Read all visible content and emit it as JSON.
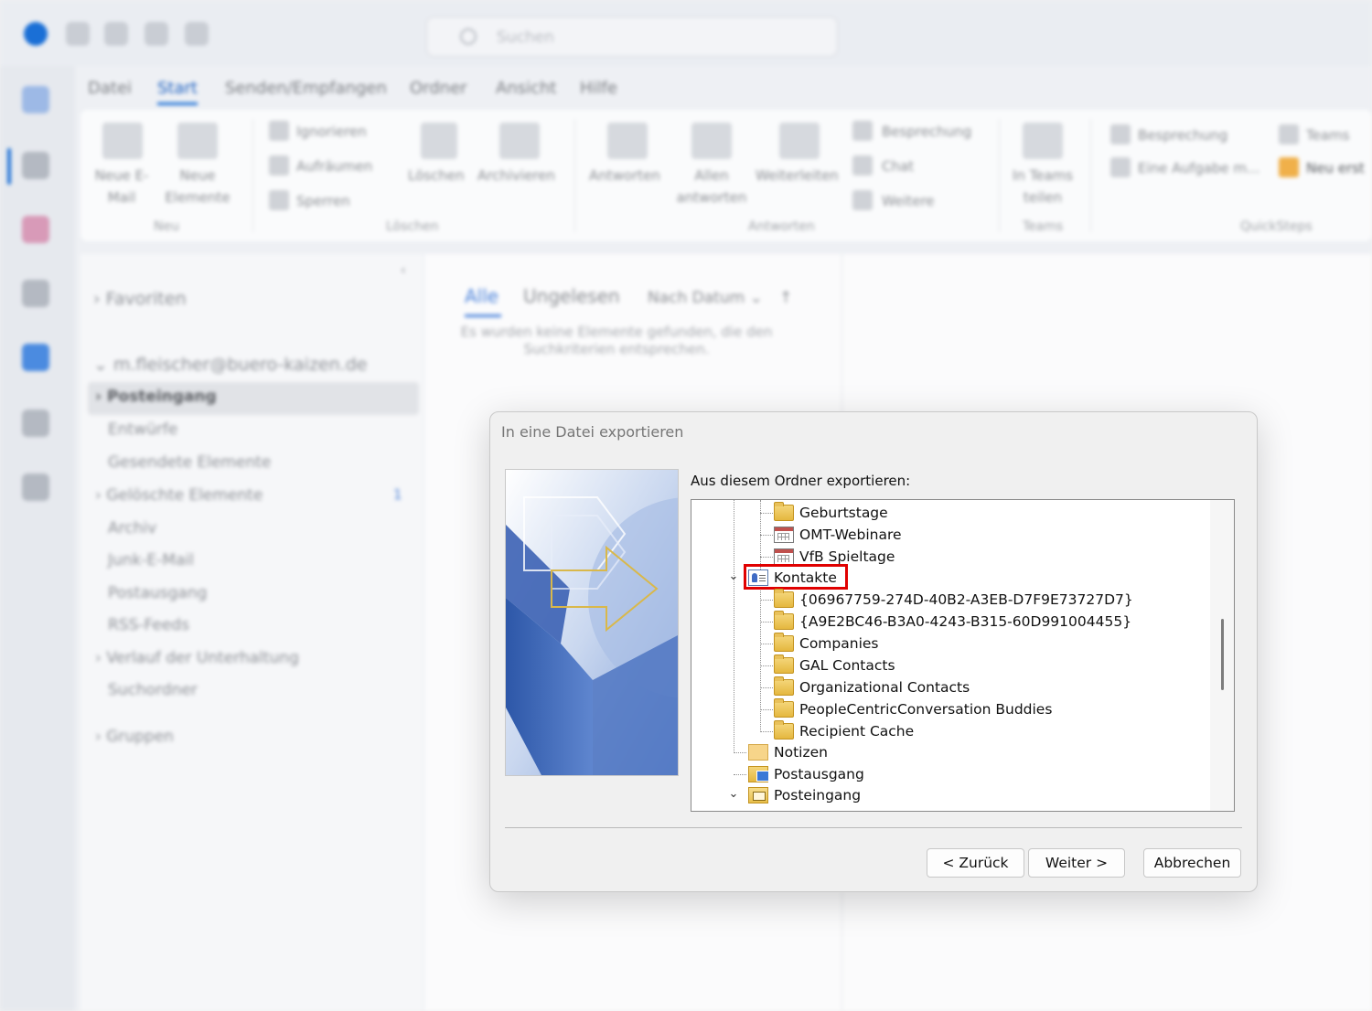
{
  "outlook": {
    "search_placeholder": "Suchen",
    "tabs": [
      "Datei",
      "Start",
      "Senden/Empfangen",
      "Ordner",
      "Ansicht",
      "Hilfe"
    ],
    "ribbon": {
      "new_mail": "Neue E-Mail",
      "new_items": "Neue Elemente",
      "ignore": "Ignorieren",
      "cleanup": "Aufräumen",
      "block": "Sperren",
      "delete": "Löschen",
      "archive": "Archivieren",
      "reply": "Antworten",
      "reply_all": "Allen antworten",
      "forward": "Weiterleiten",
      "meeting": "Besprechung",
      "chat": "Chat",
      "more": "Weitere",
      "teams_share": "In Teams teilen",
      "qs_meeting": "Besprechung",
      "qs_task": "Eine Aufgabe m...",
      "qs_team": "Teams",
      "qs_new": "Neu erst",
      "groups": [
        "Neu",
        "Löschen",
        "Antworten",
        "Teams",
        "QuickSteps"
      ]
    },
    "folders": {
      "favorites": "Favoriten",
      "account": "m.fleischer@buero-kaizen.de",
      "items": [
        "Posteingang",
        "Entwürfe",
        "Gesendete Elemente",
        "Gelöschte Elemente",
        "Archiv",
        "Junk-E-Mail",
        "Postausgang",
        "RSS-Feeds",
        "Verlauf der Unterhaltung",
        "Suchordner"
      ],
      "deleted_badge": "1",
      "groups": "Gruppen"
    },
    "messagelist": {
      "tab_all": "Alle",
      "tab_unread": "Ungelesen",
      "sort": "Nach Datum",
      "empty": "Es wurden keine Elemente gefunden, die den Suchkriterien entsprechen."
    }
  },
  "dialog": {
    "title": "In eine Datei exportieren",
    "folder_label": "Aus diesem Ordner exportieren:",
    "tree": [
      {
        "label": "Geburtstage",
        "icon": "folder-icon"
      },
      {
        "label": "OMT-Webinare",
        "icon": "calendar-icon"
      },
      {
        "label": "VfB Spieltage",
        "icon": "calendar-icon"
      },
      {
        "label": "Kontakte",
        "icon": "contacts-icon",
        "selected": true
      },
      {
        "label": "{06967759-274D-40B2-A3EB-D7F9E73727D7}",
        "icon": "folder-icon"
      },
      {
        "label": "{A9E2BC46-B3A0-4243-B315-60D991004455}",
        "icon": "folder-icon"
      },
      {
        "label": "Companies",
        "icon": "folder-icon"
      },
      {
        "label": "GAL Contacts",
        "icon": "folder-icon"
      },
      {
        "label": "Organizational Contacts",
        "icon": "folder-icon"
      },
      {
        "label": "PeopleCentricConversation Buddies",
        "icon": "folder-icon"
      },
      {
        "label": "Recipient Cache",
        "icon": "folder-icon"
      },
      {
        "label": "Notizen",
        "icon": "notes-icon"
      },
      {
        "label": "Postausgang",
        "icon": "outbox-icon"
      },
      {
        "label": "Posteingang",
        "icon": "inbox-icon"
      }
    ],
    "buttons": {
      "back": "< Zurück",
      "next": "Weiter >",
      "cancel": "Abbrechen"
    },
    "highlight_color": "#e00000"
  }
}
